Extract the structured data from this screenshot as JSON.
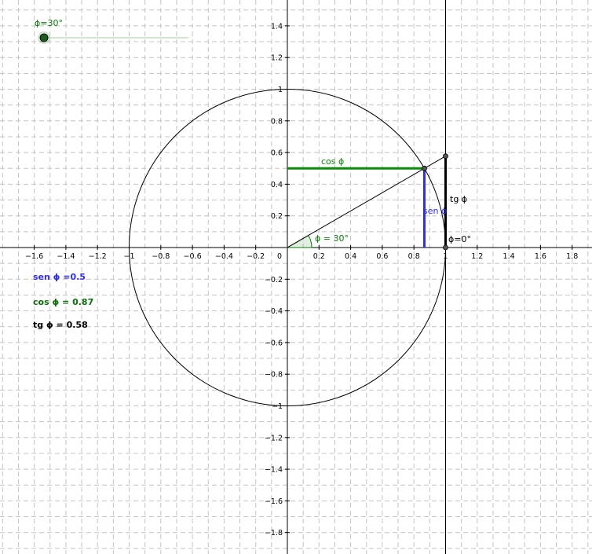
{
  "slider": {
    "label": "ϕ=30°",
    "value_deg": 30,
    "min_deg": 0,
    "max_deg": 360
  },
  "plot": {
    "x_ticks": [
      "−1.6",
      "−1.4",
      "−1.2",
      "−1",
      "−0.8",
      "−0.6",
      "−0.4",
      "−0.2",
      "0",
      "0.2",
      "0.4",
      "0.6",
      "0.8",
      "1",
      "1.2",
      "1.4",
      "1.6",
      "1.8"
    ],
    "y_ticks": [
      "1.4",
      "1.2",
      "1",
      "0.8",
      "0.6",
      "0.4",
      "0.2",
      "−0.2",
      "−0.4",
      "−0.6",
      "−0.8",
      "−1",
      "−1.2",
      "−1.4",
      "−1.6",
      "−1.8"
    ],
    "labels": {
      "cos_segment": "cos ϕ",
      "sen_segment": "sen ϕ",
      "tg_segment": "tg ϕ",
      "angle": "ϕ = 30°",
      "zero_angle": "ϕ=0°"
    }
  },
  "readouts": {
    "sen": "sen ϕ =0.5",
    "cos": "cos ϕ = 0.87",
    "tg": "tg ϕ = 0.58"
  },
  "colors": {
    "cos": "#0b8a0b",
    "sen": "#2f2ff0",
    "tg": "#000000",
    "angle": "#0b7a0b",
    "slider_point": "#1b5e1b",
    "grid": "#c4c4c4"
  }
}
